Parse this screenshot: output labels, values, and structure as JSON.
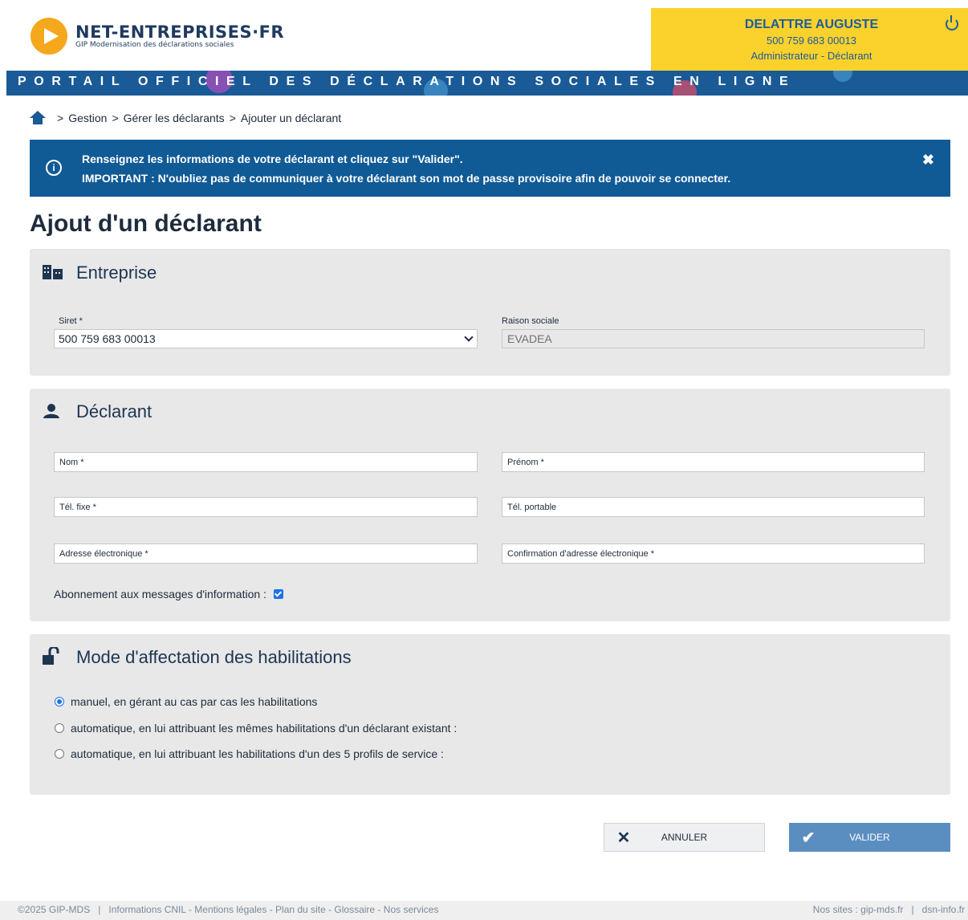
{
  "header": {
    "logo_title": "NET-ENTREPRISES·FR",
    "logo_subtitle": "GIP Modernisation des déclarations sociales",
    "user_name": "DELATTRE AUGUSTE",
    "user_siret": "500 759 683 00013",
    "user_role": "Administrateur - Déclarant",
    "banner": "PORTAIL OFFICIEL DES DÉCLARATIONS SOCIALES EN LIGNE"
  },
  "breadcrumb": {
    "items": [
      "Gestion",
      "Gérer les déclarants",
      "Ajouter un déclarant"
    ],
    "separator": ">"
  },
  "alert": {
    "line1": "Renseignez les informations de votre déclarant et cliquez sur \"Valider\".",
    "line2": "IMPORTANT : N'oubliez pas de communiquer à votre déclarant son mot de passe provisoire afin de pouvoir se connecter.",
    "icon": "info-icon",
    "close": "✖"
  },
  "page_title": "Ajout d'un déclarant",
  "entreprise": {
    "title": "Entreprise",
    "siret_label": "Siret *",
    "siret_value": "500 759 683 00013",
    "raison_label": "Raison sociale",
    "raison_value": "EVADEA"
  },
  "declarant": {
    "title": "Déclarant",
    "nom": "Nom *",
    "prenom": "Prénom *",
    "tel_fixe": "Tél. fixe *",
    "tel_portable": "Tél. portable",
    "email": "Adresse électronique *",
    "email_confirm": "Confirmation d'adresse électronique *",
    "subscribe_label": "Abonnement aux messages d'information :",
    "subscribe_checked": true
  },
  "habilitations": {
    "title": "Mode d'affectation des habilitations",
    "options": [
      "manuel, en gérant au cas par cas les habilitations",
      "automatique, en lui attribuant les mêmes habilitations d'un déclarant existant :",
      "automatique, en lui attribuant les habilitations d'un des 5 profils de service :"
    ],
    "selected": 0
  },
  "buttons": {
    "cancel": "ANNULER",
    "validate": "VALIDER"
  },
  "footer": {
    "copyright": "©2025 GIP-MDS",
    "links": [
      "Informations CNIL",
      "Mentions légales",
      "Plan du site",
      "Glossaire",
      "Nos services"
    ],
    "sites_label": "Nos sites :",
    "site1": "gip-mds.fr",
    "site2": "dsn-info.fr"
  },
  "colors": {
    "brand_blue": "#1a5a96",
    "alert_blue": "#105a96",
    "user_yellow": "#fbd22b",
    "logo_orange": "#f5a81c",
    "validate_blue": "#5b8ec0"
  }
}
